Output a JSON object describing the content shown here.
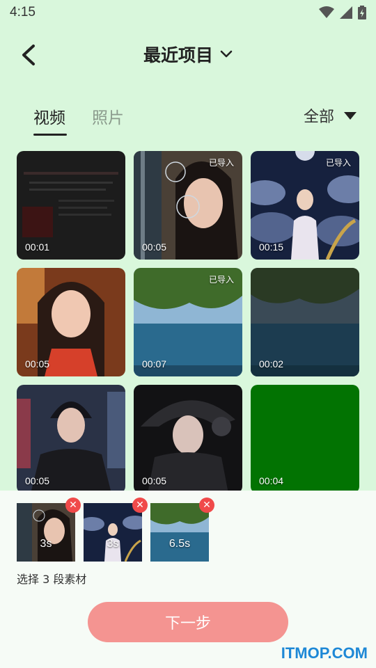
{
  "status_bar": {
    "time": "4:15",
    "icons": [
      "wifi-icon",
      "signal-icon",
      "battery-icon"
    ]
  },
  "header": {
    "title": "最近项目",
    "back_icon": "chevron-left-icon",
    "dropdown_icon": "chevron-down-icon"
  },
  "tabs": [
    {
      "label": "视频",
      "active": true
    },
    {
      "label": "照片",
      "active": false
    }
  ],
  "filter": {
    "label": "全部",
    "icon": "triangle-down-icon"
  },
  "grid": [
    {
      "duration": "00:01",
      "badge": "",
      "theme": "dark-screenshot"
    },
    {
      "duration": "00:05",
      "badge": "已导入",
      "theme": "girl-bubbles"
    },
    {
      "duration": "00:15",
      "badge": "已导入",
      "theme": "night-clouds"
    },
    {
      "duration": "00:05",
      "badge": "",
      "theme": "girl-portrait"
    },
    {
      "duration": "00:07",
      "badge": "已导入",
      "theme": "sea-tree"
    },
    {
      "duration": "00:02",
      "badge": "",
      "theme": "sea-tree-dark"
    },
    {
      "duration": "00:05",
      "badge": "",
      "theme": "boy-jacket"
    },
    {
      "duration": "00:05",
      "badge": "",
      "theme": "armor-girl"
    },
    {
      "duration": "00:04",
      "badge": "",
      "theme": "green-screen"
    }
  ],
  "selected": [
    {
      "length": "3s",
      "theme": "girl-bubbles"
    },
    {
      "length": "3s",
      "theme": "night-clouds"
    },
    {
      "length": "6.5s",
      "theme": "sea-tree"
    }
  ],
  "selection_summary": "选择 3 段素材",
  "next_button": "下一步",
  "watermark": "ITMOP.COM",
  "colors": {
    "background": "#d9f7dc",
    "next_button": "#f49491",
    "remove_badge": "#f04a4a",
    "watermark": "#1e88d6"
  }
}
